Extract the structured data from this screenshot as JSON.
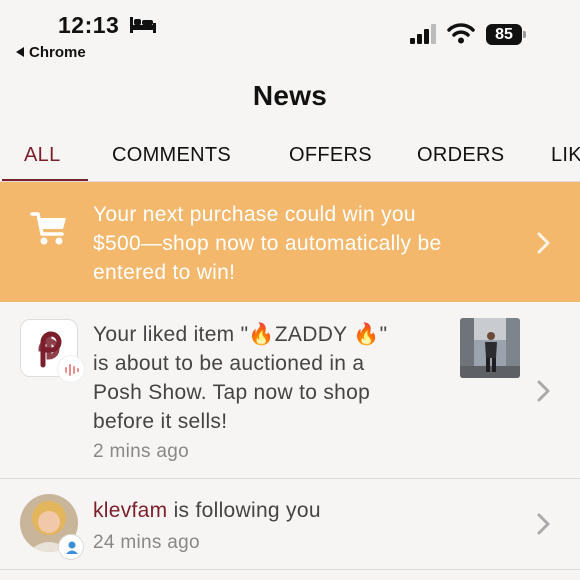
{
  "status_bar": {
    "time": "12:13",
    "back_app": "Chrome",
    "battery": "85"
  },
  "header": {
    "title": "News"
  },
  "tabs": [
    {
      "label": "ALL",
      "active": true
    },
    {
      "label": "COMMENTS",
      "active": false
    },
    {
      "label": "OFFERS",
      "active": false
    },
    {
      "label": "ORDERS",
      "active": false
    },
    {
      "label": "LIK",
      "active": false
    }
  ],
  "promo": {
    "line1": "Your next purchase could win you",
    "line2": "$500—shop now to automatically be",
    "line3": "entered to win!"
  },
  "notifications": [
    {
      "line1": "Your liked item \"🔥ZADDY 🔥\"",
      "line2": "is about to be auctioned in a",
      "line3": "Posh Show. Tap now to shop",
      "line4": "before it sells!",
      "time": "2 mins ago"
    },
    {
      "username": "klevfam",
      "action": " is following you",
      "time": "24 mins ago"
    }
  ],
  "colors": {
    "accent": "#7a1f2b",
    "promo_bg": "#f3b86c",
    "background": "#f7f5f3"
  }
}
